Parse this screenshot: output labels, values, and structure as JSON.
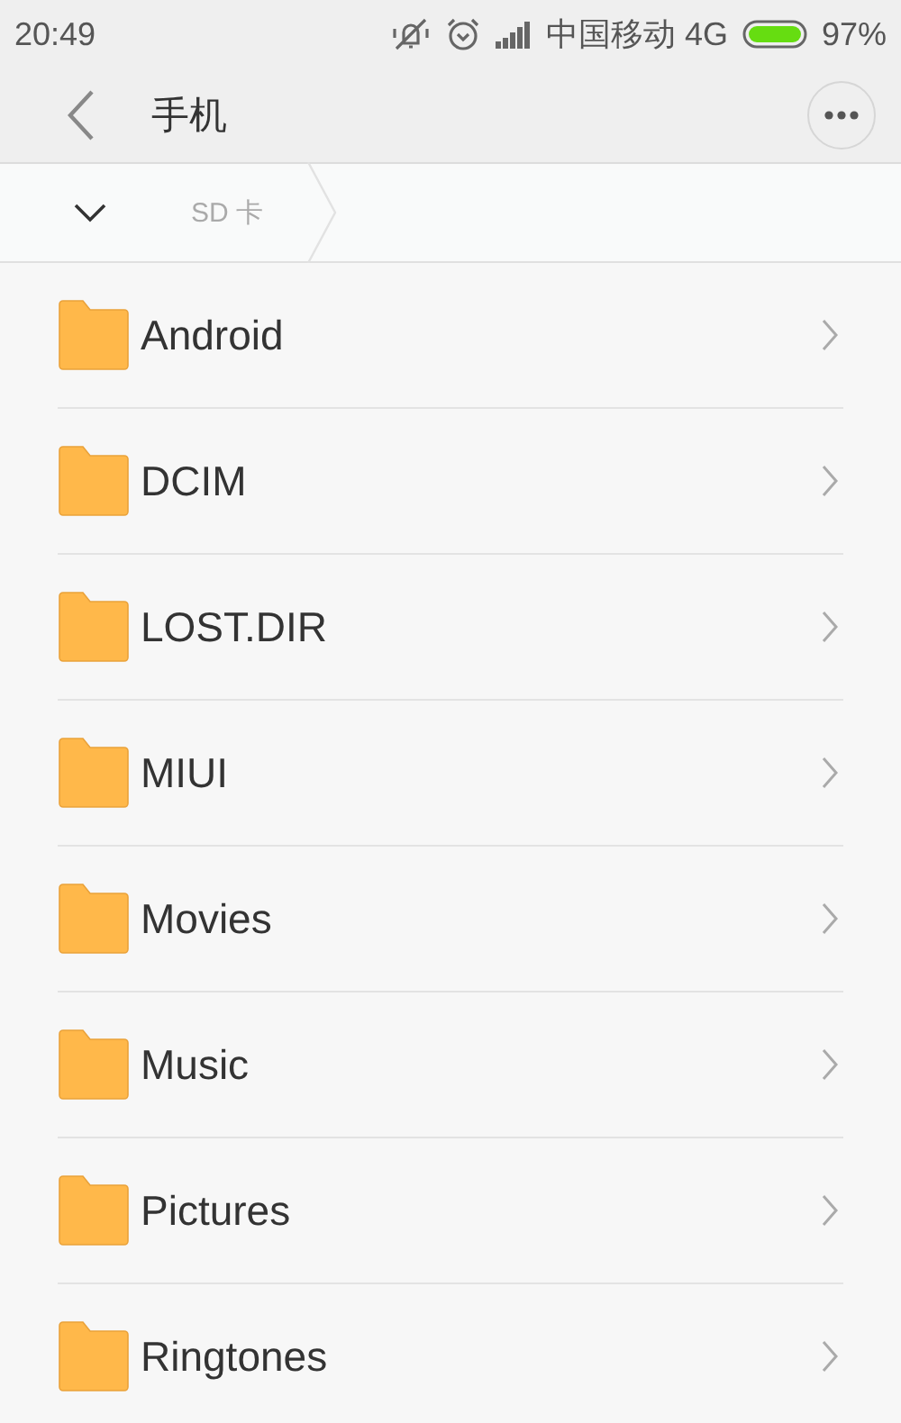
{
  "status_bar": {
    "time": "20:49",
    "carrier": "中国移动 4G",
    "battery": "97%"
  },
  "header": {
    "title": "手机"
  },
  "breadcrumb": [
    {
      "label": "SD 卡"
    }
  ],
  "folders": [
    {
      "name": "Android"
    },
    {
      "name": "DCIM"
    },
    {
      "name": "LOST.DIR"
    },
    {
      "name": "MIUI"
    },
    {
      "name": "Movies"
    },
    {
      "name": "Music"
    },
    {
      "name": "Pictures"
    },
    {
      "name": "Ringtones"
    }
  ]
}
